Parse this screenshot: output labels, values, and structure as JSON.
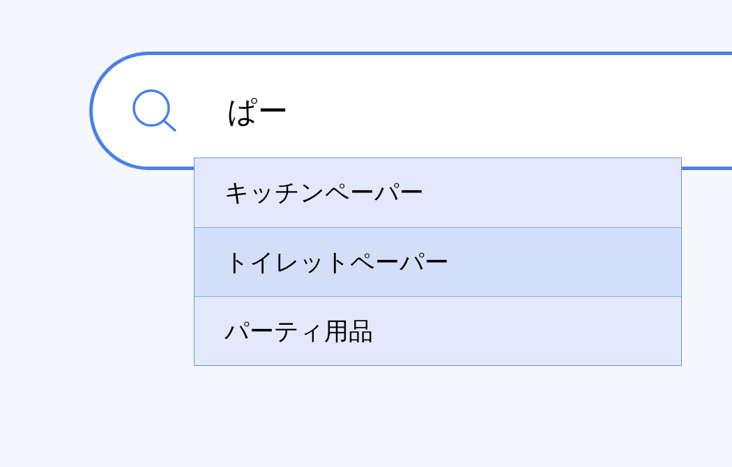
{
  "search": {
    "value": "ぱー"
  },
  "suggestions": [
    {
      "label": "キッチンペーパー",
      "selected": false
    },
    {
      "label": "トイレットペーパー",
      "selected": true
    },
    {
      "label": "パーティ用品",
      "selected": false
    }
  ]
}
